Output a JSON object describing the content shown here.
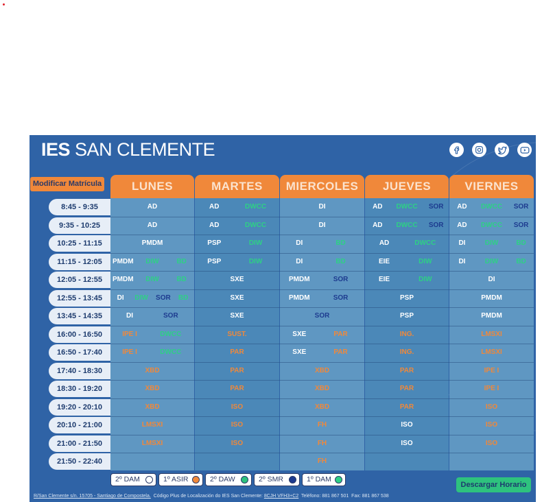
{
  "brand": {
    "bold": "IES",
    "rest": "SAN CLEMENTE"
  },
  "socials": [
    "facebook-icon",
    "instagram-icon",
    "twitter-icon",
    "youtube-icon"
  ],
  "modify_label": "Modificar Matrícula",
  "days": [
    "LUNES",
    "MARTES",
    "MIERCOLES",
    "JUEVES",
    "VIERNES"
  ],
  "times": [
    "8:45 - 9:35",
    "9:35 - 10:25",
    "10:25 - 11:15",
    "11:15 - 12:05",
    "12:05 - 12:55",
    "12:55 - 13:45",
    "13:45 - 14:35",
    "16:00 - 16:50",
    "16:50 - 17:40",
    "17:40 - 18:30",
    "18:30 - 19:20",
    "19:20 - 20:10",
    "20:10 - 21:00",
    "21:00 - 21:50",
    "21:50 - 22:40"
  ],
  "schedule": [
    [
      [
        [
          "AD",
          "w"
        ]
      ],
      [
        [
          "AD",
          "w"
        ],
        [
          "DWCC",
          "g"
        ]
      ],
      [
        [
          "DI",
          "w"
        ]
      ],
      [
        [
          "AD",
          "w"
        ],
        [
          "DWCC",
          "g"
        ],
        [
          "SOR",
          "b"
        ]
      ],
      [
        [
          "AD",
          "w"
        ],
        [
          "DWCC",
          "g"
        ],
        [
          "SOR",
          "b"
        ]
      ]
    ],
    [
      [
        [
          "AD",
          "w"
        ]
      ],
      [
        [
          "AD",
          "w"
        ],
        [
          "DWCC",
          "g"
        ]
      ],
      [
        [
          "DI",
          "w"
        ]
      ],
      [
        [
          "AD",
          "w"
        ],
        [
          "DWCC",
          "g"
        ],
        [
          "SOR",
          "b"
        ]
      ],
      [
        [
          "AD",
          "w"
        ],
        [
          "DWCC",
          "g"
        ],
        [
          "SOR",
          "b"
        ]
      ]
    ],
    [
      [
        [
          "PMDM",
          "w"
        ]
      ],
      [
        [
          "PSP",
          "w"
        ],
        [
          "DIW",
          "g"
        ]
      ],
      [
        [
          "DI",
          "w"
        ],
        [
          "BD",
          "g"
        ]
      ],
      [
        [
          "AD",
          "w"
        ],
        [
          "DWCC",
          "g"
        ]
      ],
      [
        [
          "DI",
          "w"
        ],
        [
          "DIW",
          "g"
        ],
        [
          "BD",
          "g"
        ]
      ]
    ],
    [
      [
        [
          "PMDM",
          "w"
        ],
        [
          "DIW",
          "g"
        ],
        [
          "BD",
          "g"
        ]
      ],
      [
        [
          "PSP",
          "w"
        ],
        [
          "DIW",
          "g"
        ]
      ],
      [
        [
          "DI",
          "w"
        ],
        [
          "BD",
          "g"
        ]
      ],
      [
        [
          "EIE",
          "w"
        ],
        [
          "DIW",
          "g"
        ]
      ],
      [
        [
          "DI",
          "w"
        ],
        [
          "DIW",
          "g"
        ],
        [
          "BD",
          "g"
        ]
      ]
    ],
    [
      [
        [
          "PMDM",
          "w"
        ],
        [
          "DIW",
          "g"
        ],
        [
          "BD",
          "g"
        ]
      ],
      [
        [
          "SXE",
          "w"
        ]
      ],
      [
        [
          "PMDM",
          "w"
        ],
        [
          "SOR",
          "b"
        ]
      ],
      [
        [
          "EIE",
          "w"
        ],
        [
          "DIW",
          "g"
        ]
      ],
      [
        [
          "DI",
          "w"
        ]
      ]
    ],
    [
      [
        [
          "DI",
          "w"
        ],
        [
          "DIW",
          "g"
        ],
        [
          "SOR",
          "b"
        ],
        [
          "BD",
          "g"
        ]
      ],
      [
        [
          "SXE",
          "w"
        ]
      ],
      [
        [
          "PMDM",
          "w"
        ],
        [
          "SOR",
          "b"
        ]
      ],
      [
        [
          "PSP",
          "w"
        ]
      ],
      [
        [
          "PMDM",
          "w"
        ]
      ]
    ],
    [
      [
        [
          "DI",
          "w"
        ],
        [
          "SOR",
          "b"
        ]
      ],
      [
        [
          "SXE",
          "w"
        ]
      ],
      [
        [
          "SOR",
          "b"
        ]
      ],
      [
        [
          "PSP",
          "w"
        ]
      ],
      [
        [
          "PMDM",
          "w"
        ]
      ]
    ],
    [
      [
        [
          "IPE I",
          "o"
        ],
        [
          "DWCC",
          "g"
        ]
      ],
      [
        [
          "SUST.",
          "o"
        ]
      ],
      [
        [
          "SXE",
          "w"
        ],
        [
          "PAR",
          "o"
        ]
      ],
      [
        [
          "ING.",
          "o"
        ]
      ],
      [
        [
          "LMSXI",
          "o"
        ]
      ]
    ],
    [
      [
        [
          "IPE I",
          "o"
        ],
        [
          "DWCC",
          "g"
        ]
      ],
      [
        [
          "PAR",
          "o"
        ]
      ],
      [
        [
          "SXE",
          "w"
        ],
        [
          "PAR",
          "o"
        ]
      ],
      [
        [
          "ING.",
          "o"
        ]
      ],
      [
        [
          "LMSXI",
          "o"
        ]
      ]
    ],
    [
      [
        [
          "XBD",
          "o"
        ]
      ],
      [
        [
          "PAR",
          "o"
        ]
      ],
      [
        [
          "XBD",
          "o"
        ]
      ],
      [
        [
          "PAR",
          "o"
        ]
      ],
      [
        [
          "IPE I",
          "o"
        ]
      ]
    ],
    [
      [
        [
          "XBD",
          "o"
        ]
      ],
      [
        [
          "PAR",
          "o"
        ]
      ],
      [
        [
          "XBD",
          "o"
        ]
      ],
      [
        [
          "PAR",
          "o"
        ]
      ],
      [
        [
          "IPE I",
          "o"
        ]
      ]
    ],
    [
      [
        [
          "XBD",
          "o"
        ]
      ],
      [
        [
          "ISO",
          "o"
        ]
      ],
      [
        [
          "XBD",
          "o"
        ]
      ],
      [
        [
          "PAR",
          "o"
        ]
      ],
      [
        [
          "ISO",
          "o"
        ]
      ]
    ],
    [
      [
        [
          "LMSXI",
          "o"
        ]
      ],
      [
        [
          "ISO",
          "o"
        ]
      ],
      [
        [
          "FH",
          "o"
        ]
      ],
      [
        [
          "ISO",
          "w"
        ]
      ],
      [
        [
          "ISO",
          "o"
        ]
      ]
    ],
    [
      [
        [
          "LMSXI",
          "o"
        ]
      ],
      [
        [
          "ISO",
          "o"
        ]
      ],
      [
        [
          "FH",
          "o"
        ]
      ],
      [
        [
          "ISO",
          "w"
        ]
      ],
      [
        [
          "ISO",
          "o"
        ]
      ]
    ],
    [
      [],
      [],
      [
        [
          "FH",
          "o"
        ]
      ],
      [],
      []
    ]
  ],
  "legend": [
    {
      "label": "2º DAM",
      "color": "#ffffff"
    },
    {
      "label": "1º ASIR",
      "color": "#f0883a"
    },
    {
      "label": "2º DAW",
      "color": "#2ec27e"
    },
    {
      "label": "2º SMR",
      "color": "#1d3b8f"
    },
    {
      "label": "1º DAM",
      "color": "#2ed085"
    }
  ],
  "download_label": "Descargar Horario",
  "footer": {
    "address": "R/San Clemente s/n. 15705 - Santiago de Compostela.",
    "plus_label": "Código Plus de Localización do IES San Clemente:",
    "plus_code": "8CJH VFH3+C2",
    "phone": "Teléfono: 881 867 501",
    "fax": "Fax: 881 867 538"
  }
}
